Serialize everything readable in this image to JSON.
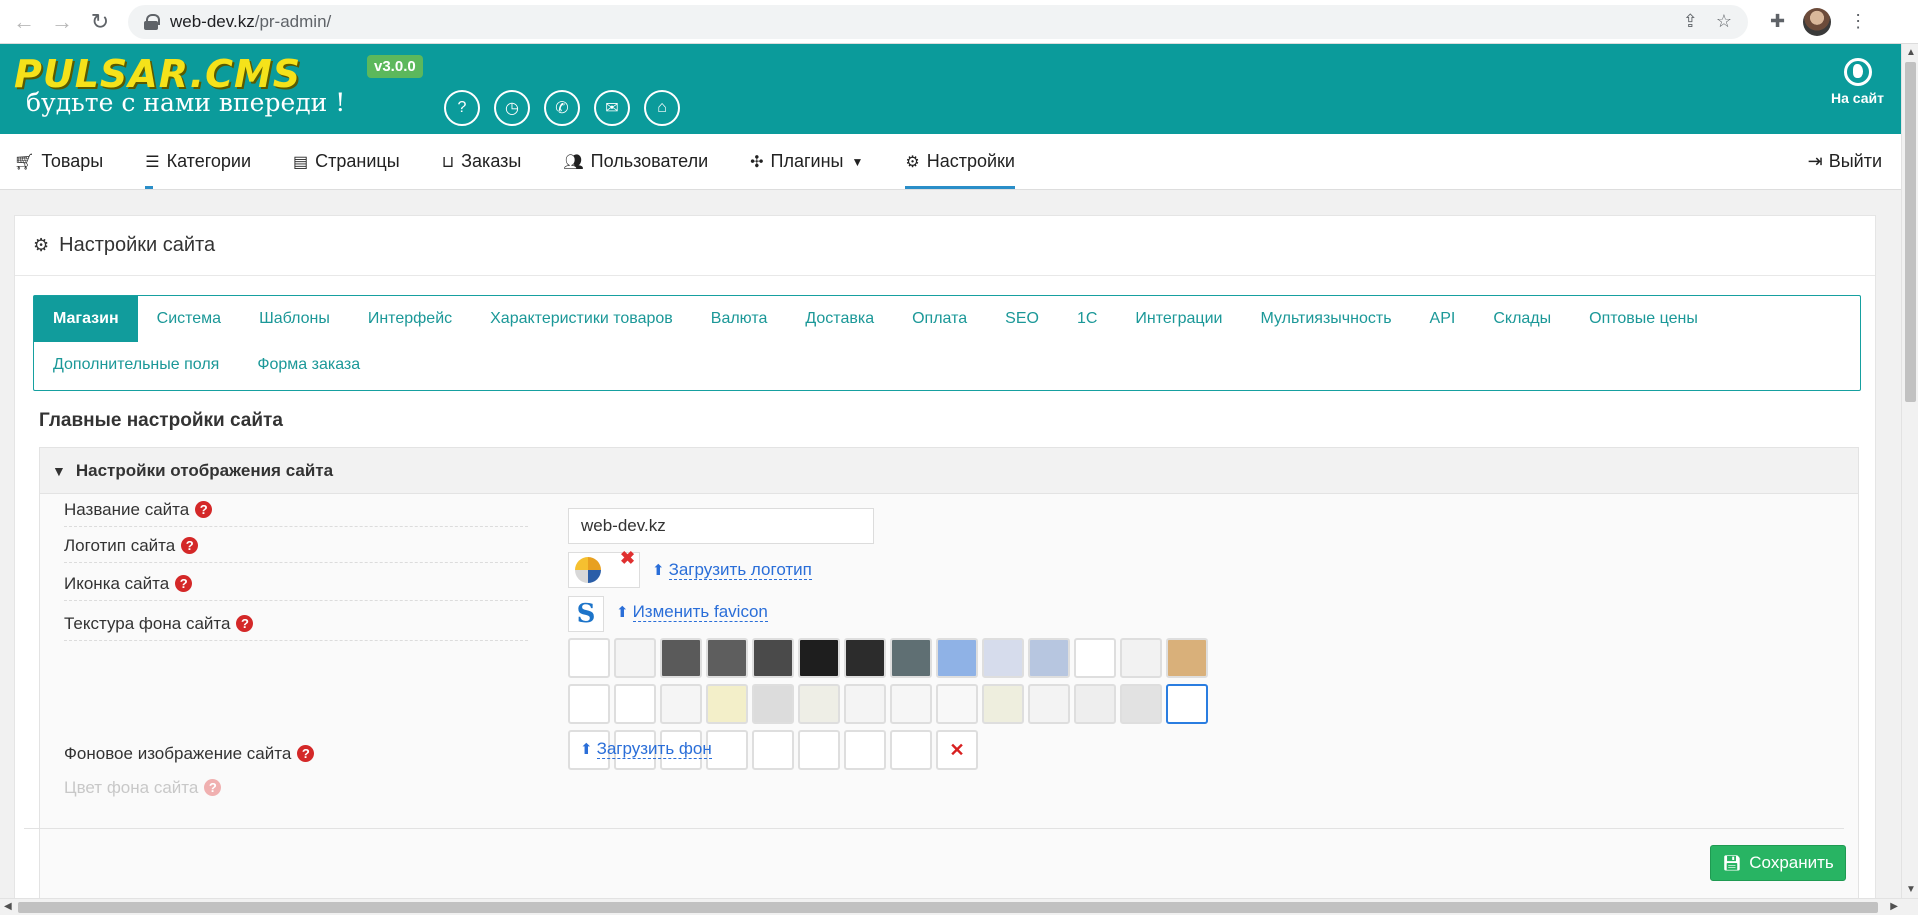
{
  "browser": {
    "url_host": "web-dev.kz",
    "url_path": "/pr-admin/"
  },
  "header": {
    "logo_text": "PULSAR.CMS",
    "logo_tagline": "будьте с нами впереди !",
    "version": "v3.0.0",
    "icons": [
      "question-icon",
      "clock-icon",
      "phone-icon",
      "chat-icon",
      "shop-icon"
    ],
    "to_site_label": "На сайт"
  },
  "menu": {
    "items": [
      {
        "label": "Товары",
        "icon": "cart-icon"
      },
      {
        "label": "Категории",
        "icon": "list-icon"
      },
      {
        "label": "Страницы",
        "icon": "page-icon"
      },
      {
        "label": "Заказы",
        "icon": "basket-icon"
      },
      {
        "label": "Пользователи",
        "icon": "users-icon"
      },
      {
        "label": "Плагины",
        "icon": "puzzle-icon"
      },
      {
        "label": "Настройки",
        "icon": "cogs-icon"
      }
    ],
    "logout_label": "Выйти"
  },
  "card": {
    "title": "Настройки сайта",
    "tabs_row1": [
      "Магазин",
      "Система",
      "Шаблоны",
      "Интерфейс",
      "Характеристики товаров",
      "Валюта",
      "Доставка",
      "Оплата",
      "SEO",
      "1С",
      "Интеграции",
      "Мультиязычность",
      "API",
      "Склады",
      "Оптовые цены"
    ],
    "tabs_row2": [
      "Дополнительные поля",
      "Форма заказа"
    ],
    "section_title": "Главные настройки сайта",
    "accordion_title": "Настройки отображения сайта"
  },
  "form": {
    "site_name_label": "Название сайта",
    "site_name_value": "web-dev.kz",
    "logo_label": "Логотип сайта",
    "logo_upload": "Загрузить логотип",
    "icon_label": "Иконка сайта",
    "icon_upload": "Изменить favicon",
    "favicon_letter": "S",
    "texture_label": "Текстура фона сайта",
    "bg_image_label": "Фоновое изображение сайта",
    "bg_upload": "Загрузить фон",
    "bg_color_label": "Цвет фона сайта",
    "help_glyph": "?",
    "save_label": "Сохранить"
  },
  "textures": {
    "row1": [
      "#ffffff",
      "#f4f4f4",
      "#5a5a5a",
      "#5e5e5e",
      "#4a4a4a",
      "#1e1e1e",
      "#2c2c2c",
      "#5f6f73",
      "#8fb2e6",
      "#d6dcec",
      "#b7c6e0",
      "#ffffff",
      "#f2f2f2",
      "#d9b07a"
    ],
    "row2": [
      "#ffffff",
      "#ffffff",
      "#f5f5f5",
      "#f3efc9",
      "#dcdcdc",
      "#eeeee6",
      "#f4f4f4",
      "#f6f6f6",
      "#f8f8f8",
      "#eeeede",
      "#f3f3f3",
      "#eeeeee",
      "#e2e2e2",
      "#ffffff"
    ],
    "row3": [
      "#ffffff",
      "#ffffff",
      "#ffffff",
      "#ffffff",
      "#ffffff",
      "#ffffff",
      "#ffffff",
      "#ffffff"
    ],
    "clear_glyph": "✕"
  },
  "colors": {
    "header_bg": "#0b9b9b",
    "tab_active": "#119c9c",
    "save_green": "#28b463",
    "link_blue": "#2a6ed8"
  }
}
